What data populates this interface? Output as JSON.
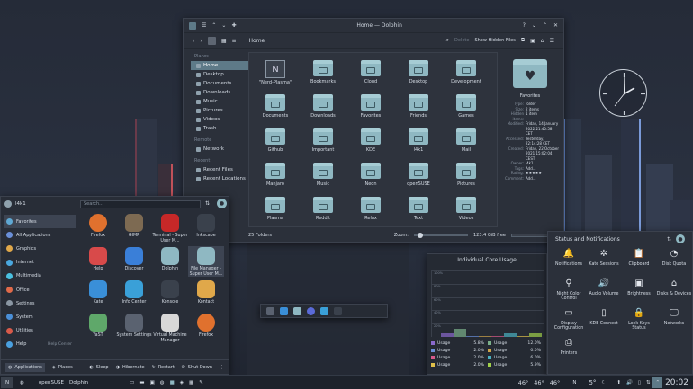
{
  "dolphin": {
    "title": "Home — Dolphin",
    "breadcrumb": "Home",
    "toolbar": {
      "delete": "Delete",
      "hidden": "Show Hidden Files"
    },
    "places_header": "Places",
    "places": [
      {
        "label": "Home",
        "selected": true
      },
      {
        "label": "Desktop"
      },
      {
        "label": "Documents"
      },
      {
        "label": "Downloads"
      },
      {
        "label": "Music"
      },
      {
        "label": "Pictures"
      },
      {
        "label": "Videos"
      },
      {
        "label": "Trash"
      }
    ],
    "remote_header": "Remote",
    "remote": [
      {
        "label": "Network"
      }
    ],
    "recent_header": "Recent",
    "recent": [
      {
        "label": "Recent Files"
      },
      {
        "label": "Recent Locations"
      }
    ],
    "files": [
      "\"Nerd-Plasma\"",
      "Bookmarks",
      "Cloud",
      "Desktop",
      "Development",
      "Documents",
      "Downloads",
      "Favorites",
      "Friends",
      "Games",
      "Github",
      "Important",
      "KDE",
      "l4k1",
      "Mail",
      "Manjaro",
      "Music",
      "Neon",
      "openSUSE",
      "Pictures",
      "Plasma",
      "Reddit",
      "Relax",
      "Text",
      "Videos"
    ],
    "info": {
      "name": "Favorites",
      "rows": [
        [
          "Type:",
          "folder"
        ],
        [
          "Size:",
          "2 items"
        ],
        [
          "Hidden items:",
          "1 item"
        ],
        [
          "Modified:",
          "Friday, 14 January 2022 21:40:58 CET"
        ],
        [
          "Accessed:",
          "Yesterday, 22:14:28 CET"
        ],
        [
          "Created:",
          "Friday, 22 October 2021 15:02:04 CEST"
        ],
        [
          "Owner:",
          "l4k1"
        ],
        [
          "Tags:",
          "Add..."
        ],
        [
          "Rating:",
          "★★★★★"
        ],
        [
          "Comment:",
          "Add..."
        ]
      ]
    },
    "status": {
      "count": "25 Folders",
      "zoom_label": "Zoom:",
      "free": "123.4 GiB free"
    }
  },
  "launcher": {
    "user": "l4k1",
    "search_placeholder": "Search...",
    "categories": [
      {
        "label": "Favorites",
        "color": "#5fa8d3",
        "selected": true
      },
      {
        "label": "All Applications",
        "color": "#6a8fd8"
      },
      {
        "label": "Graphics",
        "color": "#e0a84a"
      },
      {
        "label": "Internet",
        "color": "#4aa8e0"
      },
      {
        "label": "Multimedia",
        "color": "#4ac0e0"
      },
      {
        "label": "Office",
        "color": "#e06a4a"
      },
      {
        "label": "Settings",
        "color": "#8a96a3"
      },
      {
        "label": "System",
        "color": "#4a8fd8"
      },
      {
        "label": "Utilities",
        "color": "#d85a4a"
      },
      {
        "label": "Help",
        "color": "#4aa0e0",
        "hint": "Help Center"
      }
    ],
    "apps": [
      {
        "label": "Firefox",
        "color": "#e0712e"
      },
      {
        "label": "GIMP",
        "color": "#7d6a52"
      },
      {
        "label": "Terminal - Super User M...",
        "color": "#c62828"
      },
      {
        "label": "Inkscape",
        "color": "#3a414c"
      },
      {
        "label": "Help",
        "color": "#d84a4a"
      },
      {
        "label": "Discover",
        "color": "#3a7fd8"
      },
      {
        "label": "Dolphin",
        "color": "#8fb8c2"
      },
      {
        "label": "File Manager - Super User M...",
        "color": "#8fb8c2",
        "selected": true
      },
      {
        "label": "Kate",
        "color": "#3a8fd8"
      },
      {
        "label": "Info Center",
        "color": "#3aa0d8"
      },
      {
        "label": "Konsole",
        "color": "#3a414c"
      },
      {
        "label": "Kontact",
        "color": "#e0a84a"
      },
      {
        "label": "YaST",
        "color": "#5fa86a"
      },
      {
        "label": "System Settings",
        "color": "#5a6270"
      },
      {
        "label": "Virtual Machine Manager",
        "color": "#d8d8d8"
      },
      {
        "label": "Firefox",
        "color": "#e0712e"
      }
    ],
    "footer": {
      "applications": "Applications",
      "places": "Places",
      "sleep": "Sleep",
      "hibernate": "Hibernate",
      "restart": "Restart",
      "shutdown": "Shut Down"
    }
  },
  "status_panel": {
    "title": "Status and Notifications",
    "items": [
      {
        "label": "Notifications",
        "glyph": "🔔"
      },
      {
        "label": "Kate Sessions",
        "glyph": "✲"
      },
      {
        "label": "Clipboard",
        "glyph": "📋"
      },
      {
        "label": "Disk Quota",
        "glyph": "◔"
      },
      {
        "label": "Night Color Control",
        "glyph": "⚲"
      },
      {
        "label": "Audio Volume",
        "glyph": "🔊"
      },
      {
        "label": "Brightness",
        "glyph": "▣"
      },
      {
        "label": "Disks & Devices",
        "glyph": "⌂"
      },
      {
        "label": "Display Configuration",
        "glyph": "▭"
      },
      {
        "label": "KDE Connect",
        "glyph": "▯"
      },
      {
        "label": "Lock Keys Status",
        "glyph": "🔒"
      },
      {
        "label": "Networks",
        "glyph": "🖵"
      },
      {
        "label": "Printers",
        "glyph": "⎙"
      }
    ]
  },
  "core_usage": {
    "title": "Individual Core Usage",
    "gridlines": [
      "100%",
      "80%",
      "60%",
      "40%",
      "20%"
    ],
    "cores": [
      {
        "label": "Usage",
        "value": "5.8%",
        "color": "#8a6acd"
      },
      {
        "label": "Usage",
        "value": "12.0%",
        "color": "#7bb08a"
      },
      {
        "label": "Usage",
        "value": "2.0%",
        "color": "#6a8fd8"
      },
      {
        "label": "Usage",
        "value": "0.0%",
        "color": "#cfa54a"
      },
      {
        "label": "Usage",
        "value": "2.0%",
        "color": "#d85a8a"
      },
      {
        "label": "Usage",
        "value": "6.0%",
        "color": "#4ab0c0"
      },
      {
        "label": "Usage",
        "value": "2.0%",
        "color": "#e0c04a"
      },
      {
        "label": "Usage",
        "value": "5.9%",
        "color": "#a0d04a"
      }
    ]
  },
  "taskbar": {
    "launcher_label": "openSUSE",
    "app_label": "Dolphin",
    "temp1": "46°",
    "temp2": "46°",
    "temp3": "46°",
    "weather": "5°",
    "time": "20:02"
  }
}
